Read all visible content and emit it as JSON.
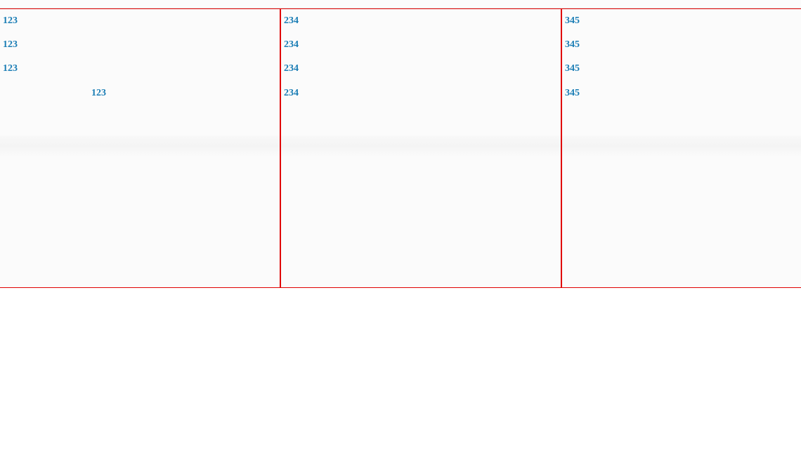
{
  "columns": [
    {
      "items": [
        {
          "label": "123",
          "indented": false
        },
        {
          "label": "123",
          "indented": false
        },
        {
          "label": "123",
          "indented": false
        },
        {
          "label": "123",
          "indented": true
        }
      ]
    },
    {
      "items": [
        {
          "label": "234",
          "indented": false
        },
        {
          "label": "234",
          "indented": false
        },
        {
          "label": "234",
          "indented": false
        },
        {
          "label": "234",
          "indented": false
        }
      ]
    },
    {
      "items": [
        {
          "label": "345",
          "indented": false
        },
        {
          "label": "345",
          "indented": false
        },
        {
          "label": "345",
          "indented": false
        },
        {
          "label": "345",
          "indented": false
        }
      ]
    }
  ]
}
